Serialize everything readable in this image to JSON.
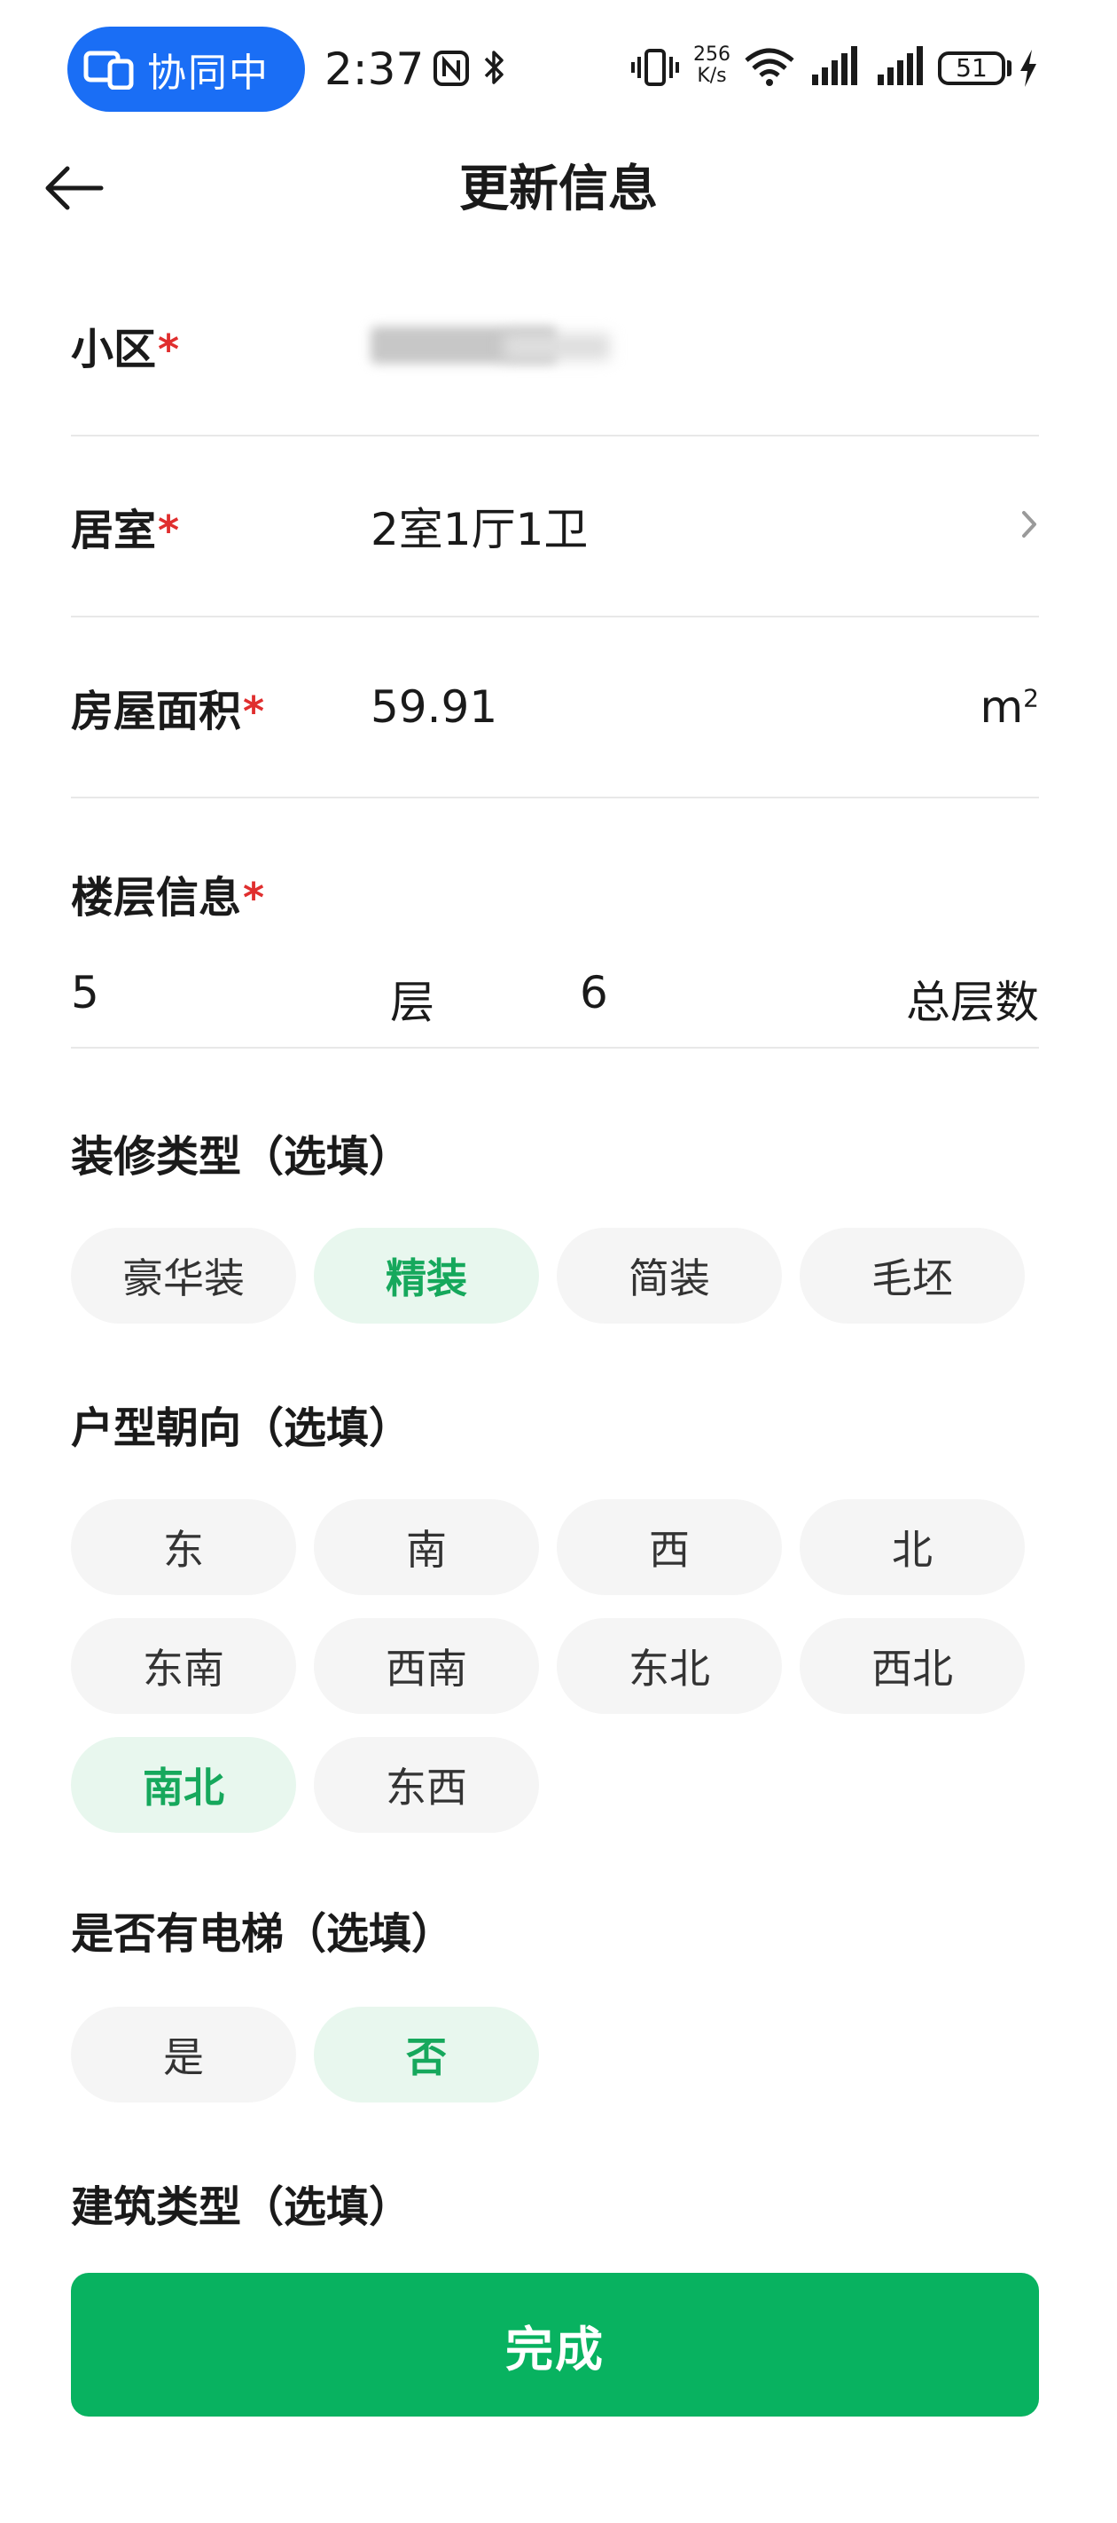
{
  "status_bar": {
    "collab_label": "协同中",
    "time": "2:37",
    "net_speed_value": "256",
    "net_speed_unit": "K/s",
    "battery_level": "51"
  },
  "header": {
    "title": "更新信息"
  },
  "form": {
    "community": {
      "label": "小区",
      "required_mark": "*"
    },
    "rooms": {
      "label": "居室",
      "required_mark": "*",
      "value": "2室1厅1卫"
    },
    "area": {
      "label": "房屋面积",
      "required_mark": "*",
      "value": "59.91",
      "unit": "m",
      "unit_sup": "2"
    },
    "floor": {
      "label": "楼层信息",
      "required_mark": "*",
      "floor_value": "5",
      "floor_unit": "层",
      "total_value": "6",
      "total_unit": "总层数"
    }
  },
  "decoration": {
    "title": "装修类型（选填）",
    "options": [
      "豪华装",
      "精装",
      "简装",
      "毛坯"
    ],
    "selected": "精装"
  },
  "orientation": {
    "title": "户型朝向（选填）",
    "options": [
      "东",
      "南",
      "西",
      "北",
      "东南",
      "西南",
      "东北",
      "西北",
      "南北",
      "东西"
    ],
    "selected": "南北"
  },
  "elevator": {
    "title": "是否有电梯（选填）",
    "options": [
      "是",
      "否"
    ],
    "selected": "否"
  },
  "building_type": {
    "title": "建筑类型（选填）"
  },
  "actions": {
    "done_label": "完成"
  },
  "colors": {
    "accent_green": "#08b260",
    "selected_chip_bg": "#e8f7ee",
    "selected_chip_text": "#16a85c",
    "required_red": "#e02e2e",
    "collab_blue": "#1a6ef5"
  }
}
